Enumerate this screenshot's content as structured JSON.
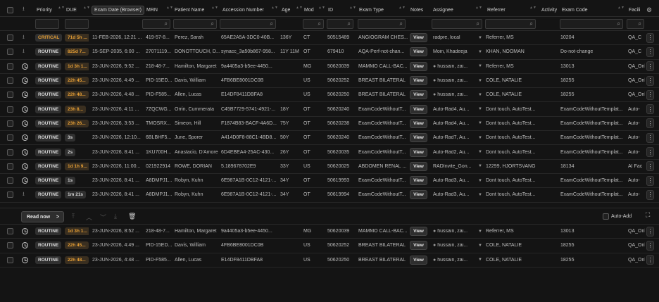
{
  "header": {
    "columns": [
      "Priority",
      "DUE",
      "Exam Date (Browser)",
      "MRN",
      "Patient Name",
      "Accession Number",
      "Age",
      "Mod",
      "ID",
      "Exam Type",
      "Notes",
      "Assignee",
      "Referrer",
      "Activity",
      "Exam Code",
      "Facili"
    ]
  },
  "main_rows": [
    {
      "icon": "download",
      "priority": "CRITICAL",
      "due": "71d 5h ...",
      "due_style": "orange",
      "exam_date": "11-FEB-2026, 12:21 ...",
      "mrn": "419-57-8...",
      "patient": "Perez, Sarah",
      "accession": "65AE2A5A-3DC0-40B...",
      "age": "136Y",
      "mod": "CT",
      "id": "50515489",
      "exam_type": "ANGIOGRAM CHES...",
      "view": "View",
      "assignee": "radpre, local",
      "assignee_dot": false,
      "referrer": "Referrer, MS",
      "exam_code": "10204",
      "facility": "QA_C"
    },
    {
      "icon": "download",
      "priority": "ROUTINE",
      "due": "825d 7...",
      "due_style": "orange",
      "exam_date": "15-SEP-2035, 6:00 ...",
      "mrn": "27071119...",
      "patient": "DONOTTOUCH, D...",
      "accession": "synacc_3a50b867-958...",
      "age": "11Y 11M",
      "mod": "OT",
      "id": "679410",
      "exam_type": "AQA-Perf-not-chan...",
      "view": "View",
      "assignee": "Moin, Khadeeja",
      "assignee_dot": false,
      "referrer": "KHAN, NOOMAN",
      "exam_code": "Do-not-change",
      "facility": "QA_C"
    },
    {
      "icon": "clock",
      "priority": "ROUTINE",
      "due": "1d 3h 1...",
      "due_style": "orange",
      "exam_date": "23-JUN-2026, 9:52 ...",
      "mrn": "218-48-7...",
      "patient": "Hamilton, Margaret",
      "accession": "9a4405a3-b5ee-4450...",
      "age": "",
      "mod": "MG",
      "id": "50620039",
      "exam_type": "MAMMO CALL-BAC...",
      "view": "View",
      "assignee": "hussain, zai...",
      "assignee_dot": true,
      "referrer": "Referrer, MS",
      "exam_code": "13013",
      "facility": "QA_Onl"
    },
    {
      "icon": "clock",
      "priority": "ROUTINE",
      "due": "22h 45...",
      "due_style": "orange",
      "exam_date": "23-JUN-2026, 4:49 ...",
      "mrn": "PID-15ED...",
      "patient": "Davis, William",
      "accession": "4FB6BE8001DC0B",
      "age": "",
      "mod": "US",
      "id": "50620252",
      "exam_type": "BREAST BILATERAL",
      "view": "View",
      "assignee": "hussain, zai...",
      "assignee_dot": true,
      "referrer": "COLE, NATALIE",
      "exam_code": "18255",
      "facility": "QA_Onl"
    },
    {
      "icon": "clock",
      "priority": "ROUTINE",
      "due": "22h 48...",
      "due_style": "orange",
      "exam_date": "23-JUN-2026, 4:48 ...",
      "mrn": "PID-F585...",
      "patient": "Allen, Lucas",
      "accession": "E14DF8411DBFA8",
      "age": "",
      "mod": "US",
      "id": "50620250",
      "exam_type": "BREAST BILATERAL",
      "view": "View",
      "assignee": "hussain, zai...",
      "assignee_dot": true,
      "referrer": "COLE, NATALIE",
      "exam_code": "18255",
      "facility": "QA_Onl"
    },
    {
      "icon": "clock",
      "priority": "ROUTINE",
      "due": "23h 8...",
      "due_style": "orange",
      "exam_date": "23-JUN-2026, 4:11 ...",
      "mrn": "7ZQCWG...",
      "patient": "Orrin, Cummerata",
      "accession": "C45B7729-5741-4921-...",
      "age": "18Y",
      "mod": "OT",
      "id": "50620240",
      "exam_type": "ExamCodeWithoutT...",
      "view": "View",
      "assignee": "Auto-Rad4, Au...",
      "assignee_dot": false,
      "referrer": "Dont touch, AutoTest...",
      "exam_code": "ExamCodeWithoutTemplat...",
      "facility": "Auto-"
    },
    {
      "icon": "clock",
      "priority": "ROUTINE",
      "due": "23h 26...",
      "due_style": "orange",
      "exam_date": "23-JUN-2026, 3:53 ...",
      "mrn": "TMOSRX...",
      "patient": "Simeon, Hill",
      "accession": "F1874B83-BACF-4A6D...",
      "age": "75Y",
      "mod": "OT",
      "id": "50620238",
      "exam_type": "ExamCodeWithoutT...",
      "view": "View",
      "assignee": "Auto-Rad4, Au...",
      "assignee_dot": false,
      "referrer": "Dont touch, AutoTest...",
      "exam_code": "ExamCodeWithoutTemplat...",
      "facility": "Auto-"
    },
    {
      "icon": "clock",
      "priority": "ROUTINE",
      "due": "3s",
      "due_style": "gray",
      "exam_date": "23-JUN-2026, 12:10...",
      "mrn": "6BLBHF5...",
      "patient": "June, Sporer",
      "accession": "A414D0F8-88C1-4BD8...",
      "age": "50Y",
      "mod": "OT",
      "id": "50620240",
      "exam_type": "ExamCodeWithoutT...",
      "view": "View",
      "assignee": "Auto-Rad7, Au...",
      "assignee_dot": false,
      "referrer": "Dont touch, AutoTest...",
      "exam_code": "ExamCodeWithoutTemplat...",
      "facility": "Auto-"
    },
    {
      "icon": "clock",
      "priority": "ROUTINE",
      "due": "2s",
      "due_style": "gray",
      "exam_date": "23-JUN-2026, 8:41 ...",
      "mrn": "1KU700H...",
      "patient": "Anastacio, D'Amore",
      "accession": "6D4EBEA4-25AC-430...",
      "age": "26Y",
      "mod": "OT",
      "id": "50620035",
      "exam_type": "ExamCodeWithoutT...",
      "view": "View",
      "assignee": "Auto-Rad2, Au...",
      "assignee_dot": false,
      "referrer": "Dont touch, AutoTest...",
      "exam_code": "ExamCodeWithoutTemplat...",
      "facility": "Auto-"
    },
    {
      "icon": "clock",
      "priority": "ROUTINE",
      "due": "1d 1h 9...",
      "due_style": "orange",
      "exam_date": "23-JUN-2026, 11:00...",
      "mrn": "021922914",
      "patient": "ROWE, DORIAN",
      "accession": "5.189678702E9",
      "age": "33Y",
      "mod": "US",
      "id": "50620025",
      "exam_type": "ABDOMEN RENAL ...",
      "view": "View",
      "assignee": "RADInvite_Gon...",
      "assignee_dot": false,
      "referrer": "12299, HJORTSVANG",
      "exam_code": "18134",
      "facility": "AI Fac"
    },
    {
      "icon": "clock",
      "priority": "ROUTINE",
      "due": "1s",
      "due_style": "gray",
      "exam_date": "23-JUN-2026, 8:41 ...",
      "mrn": "A8DMPJ1...",
      "patient": "Robyn, Kuhn",
      "accession": "6E987A1B-0C12-4121-...",
      "age": "34Y",
      "mod": "OT",
      "id": "50619993",
      "exam_type": "ExamCodeWithoutT...",
      "view": "View",
      "assignee": "Auto-Rad3, Au...",
      "assignee_dot": false,
      "referrer": "Dont touch, AutoTest...",
      "exam_code": "ExamCodeWithoutTemplat...",
      "facility": "Auto-"
    },
    {
      "icon": "download",
      "priority": "ROUTINE",
      "due": "1m 21s",
      "due_style": "gray",
      "exam_date": "23-JUN-2026, 8:41 ...",
      "mrn": "A8DMPJ1...",
      "patient": "Robyn, Kuhn",
      "accession": "6E987A1B-0C12-4121-...",
      "age": "34Y",
      "mod": "OT",
      "id": "50619994",
      "exam_type": "ExamCodeWithoutT...",
      "view": "View",
      "assignee": "Auto-Rad3, Au...",
      "assignee_dot": false,
      "referrer": "Dont touch, AutoTest...",
      "exam_code": "ExamCodeWithoutTemplat...",
      "facility": "Auto-"
    }
  ],
  "toolbar": {
    "read_now_label": "Read now",
    "auto_add_label": "Auto-Add"
  },
  "queue_rows": [
    {
      "icon": "clock",
      "priority": "ROUTINE",
      "due": "1d 3h 1...",
      "due_style": "orange",
      "exam_date": "23-JUN-2026, 8:52 ...",
      "mrn": "218-48-7...",
      "patient": "Hamilton, Margaret",
      "accession": "9a4405a3-b5ee-4450...",
      "age": "",
      "mod": "MG",
      "id": "50620039",
      "exam_type": "MAMMO CALL-BAC...",
      "view": "View",
      "assignee": "hussain, zai...",
      "assignee_dot": true,
      "referrer": "Referrer, MS",
      "exam_code": "13013",
      "facility": "QA_Onl"
    },
    {
      "icon": "clock",
      "priority": "ROUTINE",
      "due": "22h 45...",
      "due_style": "orange",
      "exam_date": "23-JUN-2026, 4:49 ...",
      "mrn": "PID-15ED...",
      "patient": "Davis, William",
      "accession": "4FB6BE8001DC0B",
      "age": "",
      "mod": "US",
      "id": "50620252",
      "exam_type": "BREAST BILATERAL",
      "view": "View",
      "assignee": "hussain, zai...",
      "assignee_dot": true,
      "referrer": "COLE, NATALIE",
      "exam_code": "18255",
      "facility": "QA_Onl"
    },
    {
      "icon": "clock",
      "priority": "ROUTINE",
      "due": "22h 48...",
      "due_style": "orange",
      "exam_date": "23-JUN-2026, 4:48 ...",
      "mrn": "PID-F585...",
      "patient": "Allen, Lucas",
      "accession": "E14DF8411DBFA8",
      "age": "",
      "mod": "US",
      "id": "50620250",
      "exam_type": "BREAST BILATERAL",
      "view": "View",
      "assignee": "hussain, zai...",
      "assignee_dot": true,
      "referrer": "COLE, NATALIE",
      "exam_code": "18255",
      "facility": "QA_Onl"
    }
  ],
  "colors": {
    "background": "#141414",
    "due_orange": "#e8a035",
    "critical": "#e8a035"
  }
}
